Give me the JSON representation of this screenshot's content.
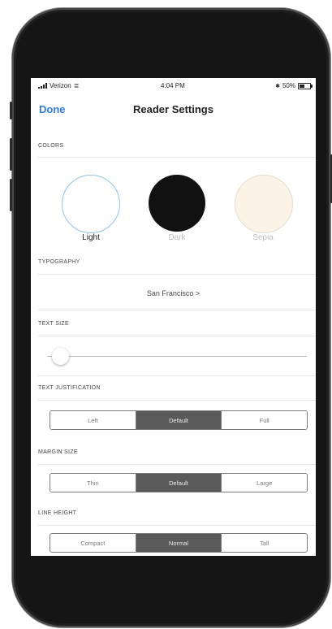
{
  "status_bar": {
    "carrier": "Verizon",
    "time": "4:04 PM",
    "battery": "50%"
  },
  "nav": {
    "done": "Done",
    "title": "Reader Settings"
  },
  "colors": {
    "label": "COLORS",
    "options": [
      {
        "name": "Light",
        "fill": "#ffffff",
        "text_color": "#222222",
        "selected": true
      },
      {
        "name": "Dark",
        "fill": "#111111",
        "text_color": "#bdbdbd",
        "selected": false
      },
      {
        "name": "Sepia",
        "fill": "#fbf3e6",
        "text_color": "#bdbdbd",
        "selected": false
      }
    ]
  },
  "typography": {
    "label": "TYPOGRAPHY",
    "font": "San Francisco >"
  },
  "text_size": {
    "label": "TEXT SIZE",
    "value_fraction": 0.05
  },
  "text_justification": {
    "label": "TEXT JUSTIFICATION",
    "options": [
      "Left",
      "Default",
      "Full"
    ],
    "selected": "Default"
  },
  "margin_size": {
    "label": "MARGIN SIZE",
    "options": [
      "Thin",
      "Default",
      "Large"
    ],
    "selected": "Default"
  },
  "line_height": {
    "label": "LINE HEIGHT",
    "options": [
      "Compact",
      "Normal",
      "Tall"
    ],
    "selected": "Normal"
  },
  "colors_palette": {
    "accent": "#2f7de1",
    "segment_active": "#5a5a5a",
    "phone_body": "#151515"
  }
}
